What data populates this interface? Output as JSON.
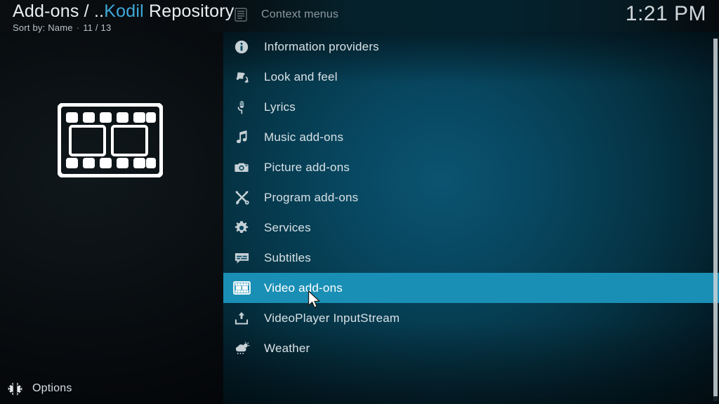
{
  "header": {
    "breadcrumb": {
      "prefix": "Add-ons / ..",
      "accent": "Kodil",
      "suffix": " Repository"
    },
    "subtitle": {
      "sort": "Sort by: Name",
      "separator": "·",
      "count": "11 / 13"
    },
    "context_menus": {
      "icon": "list-document-icon",
      "label": "Context menus"
    },
    "clock": "1:21 PM"
  },
  "artwork": {
    "icon": "film-strip-icon"
  },
  "list": {
    "selected_index": 8,
    "items": [
      {
        "icon": "info-circle-icon",
        "label": "Information providers"
      },
      {
        "icon": "paint-bucket-icon",
        "label": "Look and feel"
      },
      {
        "icon": "microphone-icon",
        "label": "Lyrics"
      },
      {
        "icon": "music-note-icon",
        "label": "Music add-ons"
      },
      {
        "icon": "camera-icon",
        "label": "Picture add-ons"
      },
      {
        "icon": "tools-icon",
        "label": "Program add-ons"
      },
      {
        "icon": "gear-icon",
        "label": "Services"
      },
      {
        "icon": "subtitles-icon",
        "label": "Subtitles"
      },
      {
        "icon": "film-strip-icon",
        "label": "Video add-ons"
      },
      {
        "icon": "upload-tray-icon",
        "label": "VideoPlayer InputStream"
      },
      {
        "icon": "weather-cloud-icon",
        "label": "Weather"
      }
    ]
  },
  "footer": {
    "options": {
      "icon": "options-cog-icon",
      "label": "Options"
    }
  },
  "colors": {
    "accent": "#1a8fb5",
    "breadcrumb_accent": "#3fa9d8",
    "panel_blue": "#07445c",
    "text_primary": "#d8e1e5",
    "text_dim": "#8d9aa0"
  }
}
